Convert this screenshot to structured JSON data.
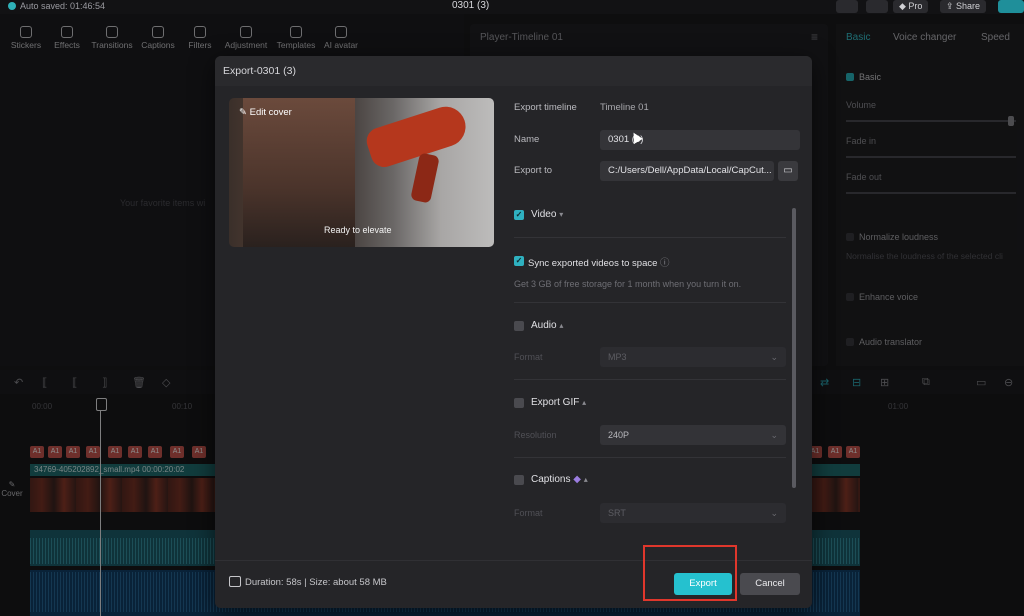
{
  "topbar": {
    "autosave": "Auto saved: 01:46:54",
    "project": "0301 (3)",
    "pro": "Pro",
    "share": "Share"
  },
  "tools": [
    "Stickers",
    "Effects",
    "Transitions",
    "Captions",
    "Filters",
    "Adjustment",
    "Templates",
    "AI avatar"
  ],
  "left_hint": "Your favorite items wi",
  "player": {
    "title": "Player-Timeline 01"
  },
  "right": {
    "tabs": [
      "Basic",
      "Voice changer",
      "Speed"
    ],
    "basic": "Basic",
    "volume": "Volume",
    "fade_in": "Fade in",
    "fade_out": "Fade out",
    "normalize": "Normalize loudness",
    "normalize_sub": "Normalise the loudness of the selected cli",
    "enhance": "Enhance voice",
    "translator": "Audio translator"
  },
  "timeline": {
    "ruler": [
      "00:00",
      "00:10",
      "01:00"
    ],
    "clip_name": "34769-405202892_small.mp4  00:00:20:02",
    "a1": "A1",
    "cover": "Cover"
  },
  "dialog": {
    "title": "Export-0301 (3)",
    "edit_cover": "Edit cover",
    "cover_caption": "Ready to elevate",
    "export_timeline_label": "Export timeline",
    "export_timeline_value": "Timeline 01",
    "name_label": "Name",
    "name_value": "0301 (3)",
    "export_to_label": "Export to",
    "export_to_value": "C:/Users/Dell/AppData/Local/CapCut...",
    "video": "Video",
    "sync": "Sync exported videos to space",
    "sync_sub": "Get 3 GB of free storage for 1 month when you turn it on.",
    "audio": "Audio",
    "format_label": "Format",
    "audio_format": "MP3",
    "gif": "Export GIF",
    "resolution_label": "Resolution",
    "gif_resolution": "240P",
    "captions": "Captions",
    "captions_format_label": "Format",
    "captions_format": "SRT",
    "footer_info": "Duration: 58s | Size: about 58 MB",
    "export_btn": "Export",
    "cancel_btn": "Cancel"
  },
  "colors": {
    "accent": "#25c1cf",
    "highlight": "#e0372c"
  }
}
